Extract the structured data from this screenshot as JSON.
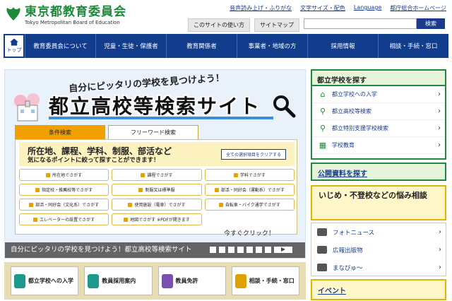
{
  "header": {
    "org_name": "東京都教育委員会",
    "org_name_en": "Tokyo Metropolitan Board of Education",
    "utility_links": [
      "音声読み上げ・ふりがな",
      "文字サイズ・配色",
      "Language",
      "都庁総合ホームページ"
    ],
    "sub_buttons": [
      "このサイトの使い方",
      "サイトマップ"
    ],
    "search_button": "検索",
    "search_placeholder": ""
  },
  "nav": {
    "home_label": "トップ",
    "items": [
      "教育委員会について",
      "児童・生徒・保護者",
      "教育関係者",
      "事業者・地域の方",
      "採用情報",
      "相談・手続・窓口"
    ]
  },
  "banner": {
    "subtitle": "自分にピッタリの学校を見つけよう！",
    "title": "都立高校等検索サイト",
    "tabs": [
      "条件検索",
      "フリーワード検索"
    ],
    "panel_line1": "所在地、課程、学科、制服、部活など",
    "panel_line2": "気になるポイントに絞って探すことができます！",
    "clear_button": "全ての選択項目をクリアする",
    "options": [
      "所在地でさがす",
      "課程でさがす",
      "学科でさがす",
      "指定校・推薦校等でさがす",
      "制服又は標準服",
      "部活・同好会（運動系）でさがす",
      "部活・同好会（文化系）でさがす",
      "使用施設（電車）でさがす",
      "自転車・バイク通学でさがす",
      "エレベーターの設置でさがす",
      "地図でさがす ※PDFが開きます",
      ""
    ],
    "click_text": "今すぐクリック！",
    "caption": "自分にピッタリの学校を見つけよう！都立高校等検索サイト"
  },
  "bottom_links": [
    "都立学校への入学",
    "教員採用案内",
    "教員免許",
    "相談・手続・窓口"
  ],
  "right": {
    "find_title": "都立学校を探す",
    "find_items": [
      "都立学校への入学",
      "都立高校等検索",
      "都立特別支援学校検索",
      "学校教育"
    ],
    "publications": "公開資料を探す",
    "bullying": "いじめ・不登校などの悩み相談",
    "misc_items": [
      "フォトニュース",
      "広報出版物",
      "まなびゅ～"
    ],
    "event": "イベント"
  },
  "colors": {
    "nav": "#123c8c",
    "brand_green": "#1d8a3a",
    "accent_orange": "#f2a000"
  }
}
